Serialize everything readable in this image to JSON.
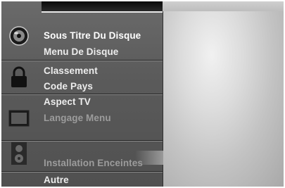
{
  "menu": {
    "sections": [
      {
        "icon": "disc-icon",
        "items": [
          {
            "label": "Sous Titre Du Disque",
            "state": "selected"
          },
          {
            "label": "Menu De Disque",
            "state": "normal"
          }
        ]
      },
      {
        "icon": "lock-icon",
        "items": [
          {
            "label": "Classement",
            "state": "normal"
          },
          {
            "label": "Code Pays",
            "state": "normal"
          }
        ]
      },
      {
        "icon": "tv-icon",
        "items": [
          {
            "label": "Aspect TV",
            "state": "normal"
          },
          {
            "label": "Langage Menu",
            "state": "dim"
          }
        ]
      },
      {
        "icon": "speaker-icon",
        "items": [
          {
            "label": "Installation Enceintes",
            "state": "dim"
          }
        ]
      },
      {
        "icon": "",
        "items": [
          {
            "label": "Autre",
            "state": "normal"
          }
        ]
      }
    ]
  }
}
